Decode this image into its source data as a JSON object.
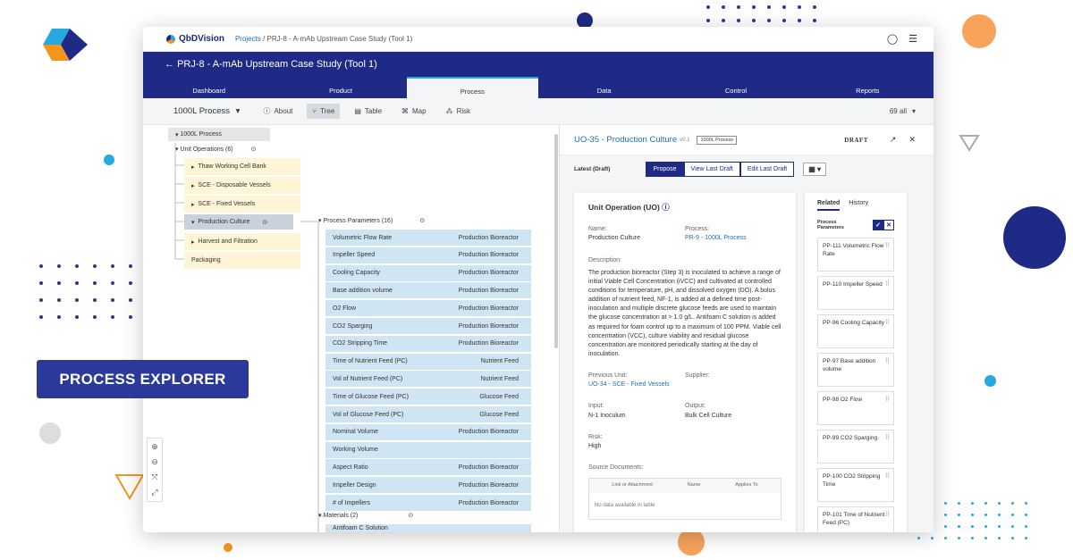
{
  "banner": {
    "label": "PROCESS EXPLORER"
  },
  "topbar": {
    "brand": "QbDVision",
    "crumb_projects": "Projects",
    "crumb_sep": "/",
    "crumb_current": "PRJ-8 - A-mAb Upstream Case Study (Tool 1)"
  },
  "header": {
    "title": "PRJ-8 - A-mAb Upstream Case Study (Tool 1)",
    "back_arrow": "←"
  },
  "tabs": [
    {
      "label": "Dashboard"
    },
    {
      "label": "Product"
    },
    {
      "label": "Process"
    },
    {
      "label": "Data"
    },
    {
      "label": "Control"
    },
    {
      "label": "Reports"
    }
  ],
  "toolbar": {
    "process": "1000L Process",
    "about": "About",
    "tree": "Tree",
    "table": "Table",
    "map": "Map",
    "risk": "Risk",
    "count": "69 all"
  },
  "tree": {
    "root": "1000L Process",
    "unit_ops_label": "Unit Operations (6)",
    "unit_ops": [
      {
        "label": "Thaw Working Cell Bank"
      },
      {
        "label": "SCE - Disposable Vessels"
      },
      {
        "label": "SCE - Fixed Vessels"
      },
      {
        "label": "Production Culture"
      },
      {
        "label": "Harvest and Filtration"
      },
      {
        "label": "Packaging"
      }
    ],
    "pp_label": "Process Parameters (16)",
    "params": [
      {
        "name": "Volumetric Flow Rate",
        "group": "Production Bioreactor"
      },
      {
        "name": "Impeller Speed",
        "group": "Production Bioreactor"
      },
      {
        "name": "Cooling Capacity",
        "group": "Production Bioreactor"
      },
      {
        "name": "Base addition volume",
        "group": "Production Bioreactor"
      },
      {
        "name": "O2 Flow",
        "group": "Production Bioreactor"
      },
      {
        "name": "CO2 Sparging",
        "group": "Production Bioreactor"
      },
      {
        "name": "CO2 Stripping Time",
        "group": "Production Bioreactor"
      },
      {
        "name": "Time of Nutrient Feed (PC)",
        "group": "Nutrient Feed"
      },
      {
        "name": "Vol of Nutrient Feed (PC)",
        "group": "Nutrient Feed"
      },
      {
        "name": "Time of Glucose Feed (PC)",
        "group": "Glucose Feed"
      },
      {
        "name": "Vol of Glucose Feed (PC)",
        "group": "Glucose Feed"
      },
      {
        "name": "Nominal Volume",
        "group": "Production Bioreactor"
      },
      {
        "name": "Working Volume",
        "group": ""
      },
      {
        "name": "Aspect Ratio",
        "group": "Production Bioreactor"
      },
      {
        "name": "Impeller Design",
        "group": "Production Bioreactor"
      },
      {
        "name": "# of Impellers",
        "group": "Production Bioreactor"
      }
    ],
    "materials_label": "Materials (2)",
    "material_partial": "Antifoam C Solution"
  },
  "detail": {
    "title": "UO-35 - Production Culture",
    "version": "v0.1",
    "badge": "1000L Process",
    "draft": "DRAFT",
    "latest": "Latest (Draft)",
    "propose": "Propose",
    "view_last": "View Last Draft",
    "edit_last": "Edit Last Draft",
    "card_title": "Unit Operation (UO)",
    "name_label": "Name:",
    "name_value": "Production Culture",
    "process_label": "Process:",
    "process_value": "PR-9 - 1000L Process",
    "desc_label": "Description:",
    "desc_value": "The production bioreactor (Step 3) is inoculated to achieve a range of initial Viable Cell Concentration (iVCC) and cultivated at controlled conditions for temperature, pH, and dissolved oxygen (DO). A bolus addition of nutrient feed, NF-1, is added at a defined time post-inoculation and multiple discrete glucose feeds are used to maintain the glucose concentration at > 1.0 g/L. Antifoam C solution is added as required for foam control up to a maximum of 100 PPM. Viable cell concentration (VCC), culture viability and residual glucose concentration are monitored periodically starting at the day of inoculation.",
    "prev_label": "Previous Unit:",
    "prev_value": "UO-34 - SCE - Fixed Vessels",
    "supplier_label": "Supplier:",
    "input_label": "Input:",
    "input_value": "N-1 Inoculum",
    "output_label": "Output:",
    "output_value": "Bulk Cell Culture",
    "risk_label": "Risk:",
    "risk_value": "High",
    "source_label": "Source Documents:",
    "cols": [
      "Link or Attachment",
      "Name",
      "Applies To"
    ],
    "empty": "No data available in table"
  },
  "related": {
    "tab_related": "Related",
    "tab_history": "History",
    "pp_header": "Process Parameters",
    "items": [
      {
        "label": "PP-111 Volumetric Flow Rate"
      },
      {
        "label": "PP-110 Impeller Speed"
      },
      {
        "label": "PP-96 Cooling Capacity"
      },
      {
        "label": "PP-97 Base addition volume"
      },
      {
        "label": "PP-98 O2 Flow"
      },
      {
        "label": "PP-99 CO2 Sparging"
      },
      {
        "label": "PP-100 CO2 Stripping Time"
      },
      {
        "label": "PP-101 Time of Nutrient Feed (PC)"
      }
    ]
  },
  "colors": {
    "navy": "#1e2a85",
    "accent": "#29a8e0",
    "orange": "#f7941d",
    "param_bg": "#cfe5f4",
    "uo_bg": "#fdf5d6"
  }
}
